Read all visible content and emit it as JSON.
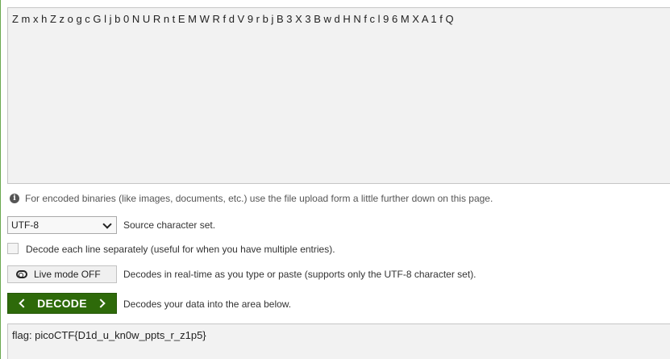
{
  "input": {
    "value": "Z m x h Z z o g c G l j b 0 N U R n t E M W R f d V 9 r b j B 3 X 3 B w d H N f c l 9 6 M X A 1 f Q"
  },
  "info": {
    "icon": "info-icon",
    "text": "For encoded binaries (like images, documents, etc.) use the file upload form a little further down on this page."
  },
  "charset": {
    "selected": "UTF-8",
    "label": "Source character set."
  },
  "line_option": {
    "label": "Decode each line separately (useful for when you have multiple entries).",
    "checked": false
  },
  "live_mode": {
    "button_label": "Live mode OFF",
    "icon": "toggle-off-icon",
    "description": "Decodes in real-time as you type or paste (supports only the UTF-8 character set)."
  },
  "decode": {
    "button_label": "DECODE",
    "description": "Decodes your data into the area below.",
    "color": "#2e6a0a"
  },
  "output": {
    "value": "flag: picoCTF{D1d_u_kn0w_ppts_r_z1p5}"
  }
}
